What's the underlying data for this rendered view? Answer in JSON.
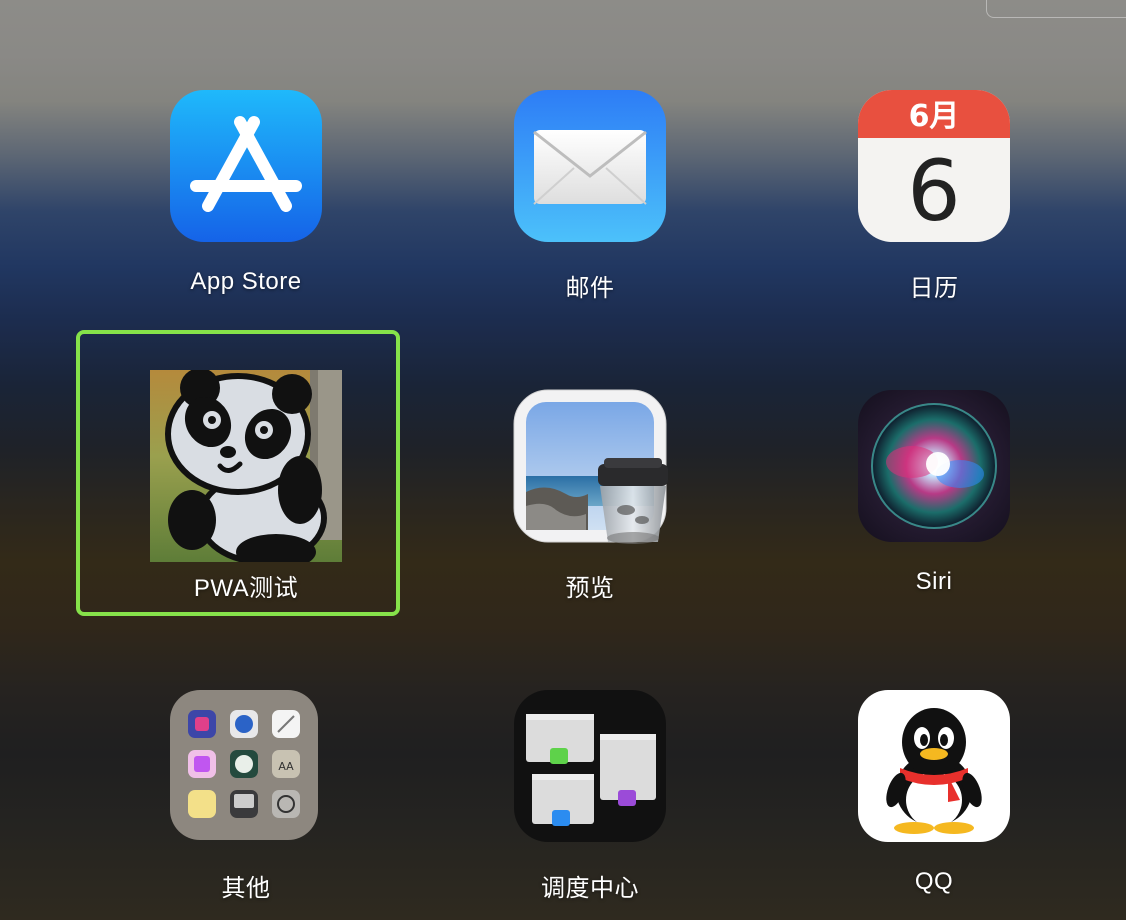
{
  "apps": [
    {
      "label": "App Store",
      "icon": "app-store-icon"
    },
    {
      "label": "邮件",
      "icon": "mail-icon"
    },
    {
      "label": "日历",
      "icon": "calendar-icon",
      "calendar_month": "6月",
      "calendar_day": "6"
    },
    {
      "label": "PWA测试",
      "icon": "panda-icon",
      "focused": true
    },
    {
      "label": "预览",
      "icon": "preview-icon"
    },
    {
      "label": "Siri",
      "icon": "siri-icon"
    },
    {
      "label": "其他",
      "icon": "folder-icon"
    },
    {
      "label": "调度中心",
      "icon": "mission-control-icon"
    },
    {
      "label": "QQ",
      "icon": "qq-penguin-icon"
    }
  ],
  "colors": {
    "focus_ring": "#86e24a",
    "app_store_blue": "#1a7cf5",
    "calendar_red": "#e8503f",
    "qq_scarf": "#e8302c"
  }
}
